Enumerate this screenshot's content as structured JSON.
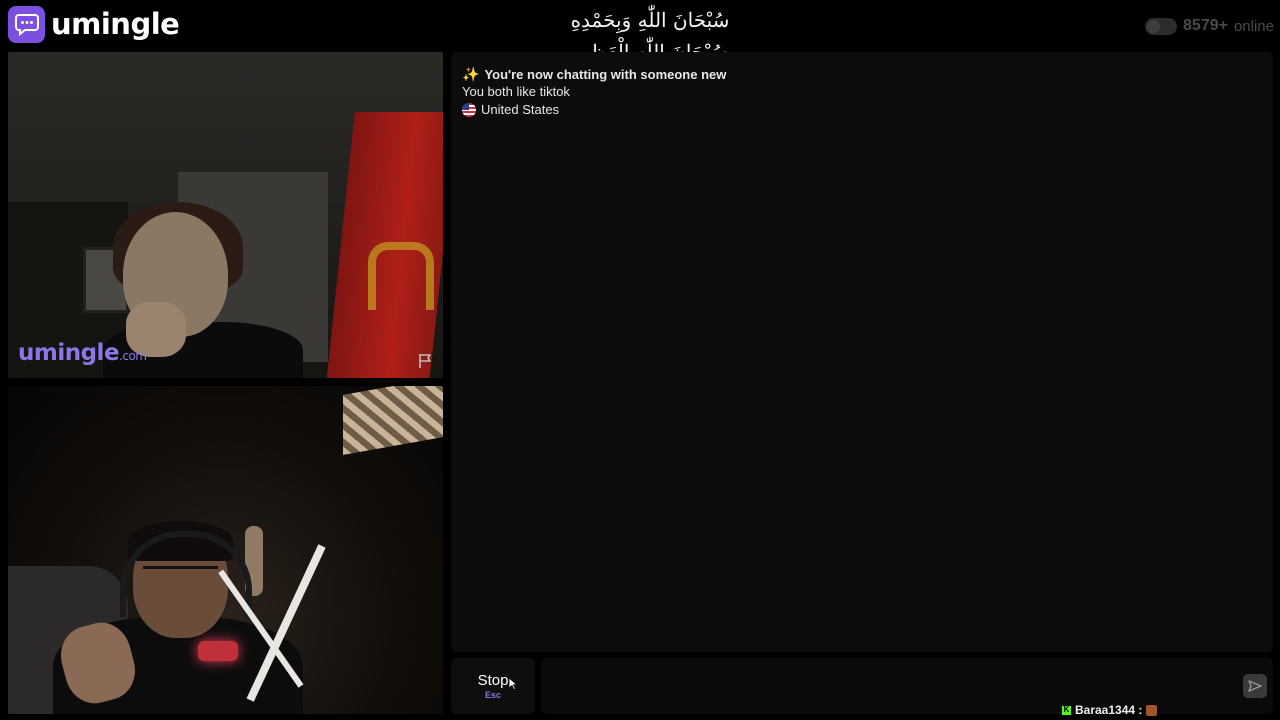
{
  "header": {
    "logo_text": "umingle",
    "online_count": "8579+",
    "online_label": "online"
  },
  "overlay": {
    "line1": "سُبْحَانَ اللّٰهِ وَبِحَمْدِهِ",
    "line2": "سُبْحَانَ اللّٰهِ الْعَظِيمِ"
  },
  "video": {
    "watermark_main": "umingle",
    "watermark_suffix": ".com"
  },
  "chat": {
    "messages": [
      {
        "icon": "sparkle",
        "text": "You're now chatting with someone new"
      },
      {
        "text": "You both like tiktok"
      },
      {
        "icon": "us-flag",
        "text": "United States"
      }
    ]
  },
  "controls": {
    "stop_label": "Stop",
    "stop_shortcut": "Esc",
    "message_placeholder": ""
  },
  "stream_overlay": {
    "username": "Baraa1344 :"
  }
}
